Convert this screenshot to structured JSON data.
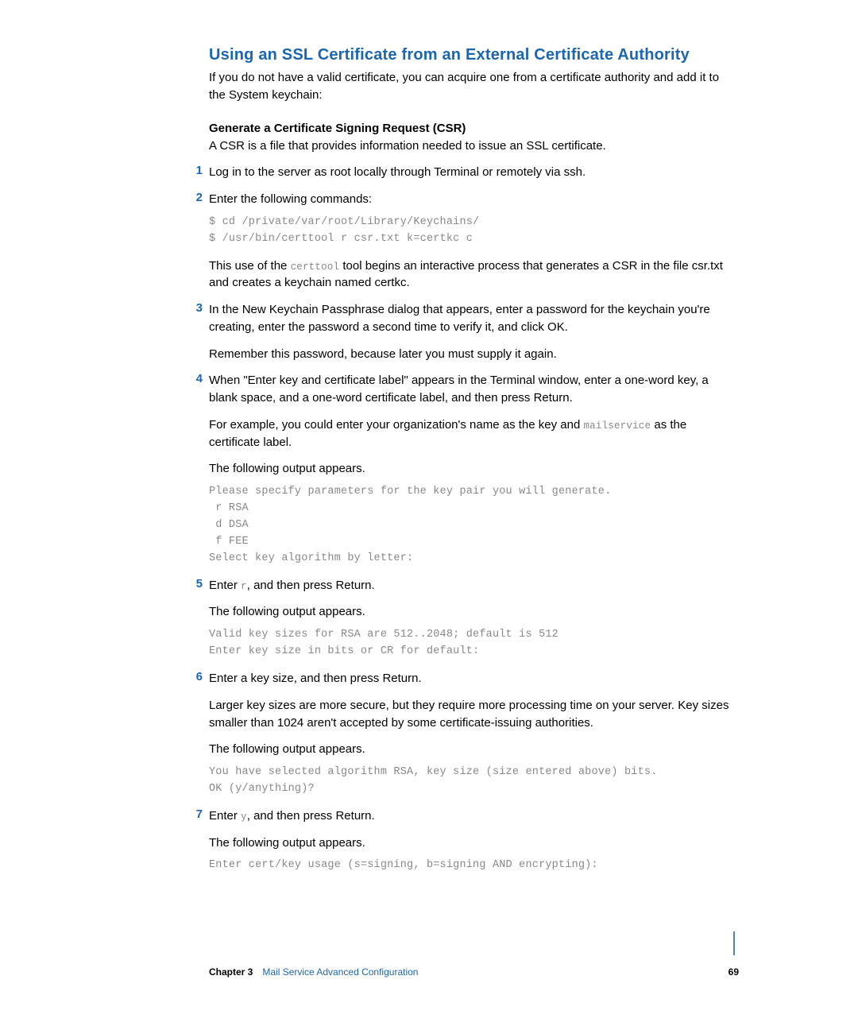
{
  "section": {
    "title": "Using an SSL Certificate from an External Certificate Authority",
    "intro": "If you do not have a valid certificate, you can acquire one from a certificate authority and add it to the System keychain:"
  },
  "subsection": {
    "head": "Generate a Certificate Signing Request (CSR)",
    "desc": "A CSR is a file that provides information needed to issue an SSL certificate."
  },
  "steps": {
    "s1": {
      "num": "1",
      "text": "Log in to the server as root locally through Terminal or remotely via ssh."
    },
    "s2": {
      "num": "2",
      "text": "Enter the following commands:",
      "code": "$ cd /private/var/root/Library/Keychains/\n$ /usr/bin/certtool r csr.txt k=certkc c",
      "after_a": "This use of the ",
      "after_code": "certtool",
      "after_b": " tool begins an interactive process that generates a CSR in the file csr.txt and creates a keychain named certkc."
    },
    "s3": {
      "num": "3",
      "text": "In the New Keychain Passphrase dialog that appears, enter a password for the keychain you're creating, enter the password a second time to verify it, and click OK.",
      "para": "Remember this password, because later you must supply it again."
    },
    "s4": {
      "num": "4",
      "text": "When \"Enter key and certificate label\" appears in the Terminal window, enter a one-word key, a blank space, and a one-word certificate label, and then press Return.",
      "para_a": "For example, you could enter your organization's name as the key and ",
      "para_code": "mailservice",
      "para_b": " as the certificate label.",
      "para2": "The following output appears.",
      "code": "Please specify parameters for the key pair you will generate.\n r RSA\n d DSA\n f FEE\nSelect key algorithm by letter:"
    },
    "s5": {
      "num": "5",
      "text_a": "Enter ",
      "text_code": "r",
      "text_b": ", and then press Return.",
      "para": "The following output appears.",
      "code": "Valid key sizes for RSA are 512..2048; default is 512\nEnter key size in bits or CR for default:"
    },
    "s6": {
      "num": "6",
      "text": "Enter a key size, and then press Return.",
      "para": "Larger key sizes are more secure, but they require more processing time on your server. Key sizes smaller than 1024 aren't accepted by some certificate-issuing authorities.",
      "para2": "The following output appears.",
      "code": "You have selected algorithm RSA, key size (size entered above) bits.\nOK (y/anything)?"
    },
    "s7": {
      "num": "7",
      "text_a": "Enter ",
      "text_code": "y",
      "text_b": ", and then press Return.",
      "para": "The following output appears.",
      "code": "Enter cert/key usage (s=signing, b=signing AND encrypting):"
    }
  },
  "footer": {
    "chapter_label": "Chapter 3",
    "chapter_title": "Mail Service Advanced Configuration",
    "page": "69"
  }
}
